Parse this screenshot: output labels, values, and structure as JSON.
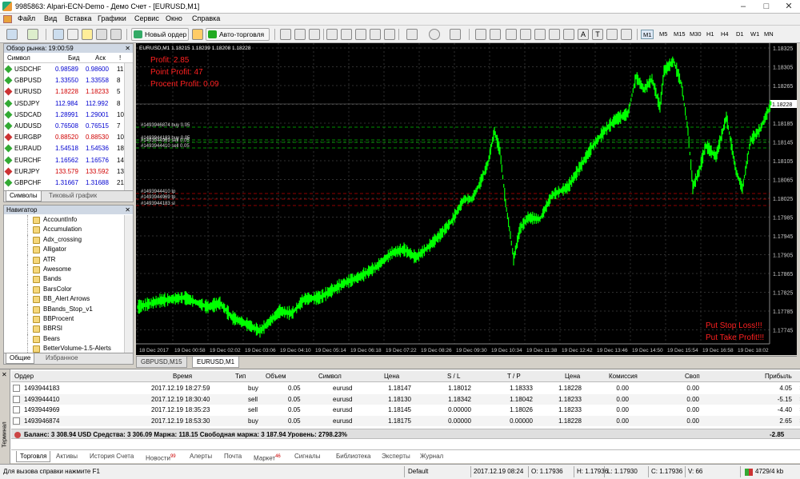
{
  "window": {
    "title": "9985863: Alpari-ECN-Demo - Демо Счет - [EURUSD,M1]"
  },
  "menu": [
    "Файл",
    "Вид",
    "Вставка",
    "Графики",
    "Сервис",
    "Окно",
    "Справка"
  ],
  "toolbar": {
    "new_order": "Новый ордер",
    "auto_trading": "Авто-торговля",
    "timeframes": [
      "M1",
      "M5",
      "M15",
      "M30",
      "H1",
      "H4",
      "D1",
      "W1",
      "MN"
    ],
    "selected_tf": "M1",
    "text_tool": "A",
    "text_tool2": "T"
  },
  "market_watch": {
    "title": "Обзор рынка: 19:00:59",
    "columns": {
      "symbol": "Символ",
      "bid": "Бид",
      "ask": "Аск",
      "spread": "!"
    },
    "rows": [
      {
        "symbol": "USDCHF",
        "bid": "0.98589",
        "ask": "0.98600",
        "spread": "11",
        "dir": "up"
      },
      {
        "symbol": "GBPUSD",
        "bid": "1.33550",
        "ask": "1.33558",
        "spread": "8",
        "dir": "up"
      },
      {
        "symbol": "EURUSD",
        "bid": "1.18228",
        "ask": "1.18233",
        "spread": "5",
        "dir": "down"
      },
      {
        "symbol": "USDJPY",
        "bid": "112.984",
        "ask": "112.992",
        "spread": "8",
        "dir": "up"
      },
      {
        "symbol": "USDCAD",
        "bid": "1.28991",
        "ask": "1.29001",
        "spread": "10",
        "dir": "up"
      },
      {
        "symbol": "AUDUSD",
        "bid": "0.76508",
        "ask": "0.76515",
        "spread": "7",
        "dir": "up"
      },
      {
        "symbol": "EURGBP",
        "bid": "0.88520",
        "ask": "0.88530",
        "spread": "10",
        "dir": "down"
      },
      {
        "symbol": "EURAUD",
        "bid": "1.54518",
        "ask": "1.54536",
        "spread": "18",
        "dir": "up"
      },
      {
        "symbol": "EURCHF",
        "bid": "1.16562",
        "ask": "1.16576",
        "spread": "14",
        "dir": "up"
      },
      {
        "symbol": "EURJPY",
        "bid": "133.579",
        "ask": "133.592",
        "spread": "13",
        "dir": "down"
      },
      {
        "symbol": "GBPCHF",
        "bid": "1.31667",
        "ask": "1.31688",
        "spread": "21",
        "dir": "up"
      },
      {
        "symbol": "CADJPY",
        "bid": "87.583",
        "ask": "87.601",
        "spread": "18",
        "dir": "up"
      }
    ],
    "tabs": [
      "Символы",
      "Тиковый график"
    ]
  },
  "navigator": {
    "title": "Навигатор",
    "items": [
      "AccountInfo",
      "Accumulation",
      "Adx_crossing",
      "Alligator",
      "ATR",
      "Awesome",
      "Bands",
      "BarsColor",
      "BB_Alert Arrows",
      "BBands_Stop_v1",
      "BBProcent",
      "BBRSI",
      "Bears",
      "BetterVolume-1.5-Alerts"
    ],
    "tabs": [
      "Общие",
      "Избранное"
    ]
  },
  "chart": {
    "header": "EURUSD,M1  1.18215 1.18239 1.18208 1.18228",
    "overlay": [
      "Profit: 2.85",
      "Point Profit: 47",
      "Procent Profit: 0.09"
    ],
    "bottom_right": [
      "Put Stop Loss!!!",
      "Put Take Profit!!!"
    ],
    "price_labels": [
      "1.18325",
      "1.18305",
      "1.18265",
      "1.18228",
      "1.18185",
      "1.18145",
      "1.18105",
      "1.18065",
      "1.18025",
      "1.17985",
      "1.17945",
      "1.17905",
      "1.17865",
      "1.17825",
      "1.17785",
      "1.17745"
    ],
    "current_price": "1.18228",
    "time_labels": [
      "18 Dec 2017",
      "19 Dec 00:58",
      "19 Dec 02:02",
      "19 Dec 03:06",
      "19 Dec 04:10",
      "19 Dec 05:14",
      "19 Dec 06:18",
      "19 Dec 07:22",
      "19 Dec 08:26",
      "19 Dec 09:30",
      "19 Dec 10:34",
      "19 Dec 11:38",
      "19 Dec 12:42",
      "19 Dec 13:46",
      "19 Dec 14:50",
      "19 Dec 15:54",
      "19 Dec 16:58",
      "19 Dec 18:02"
    ],
    "order_lines": [
      {
        "label": "#1493946874 buy 0.05",
        "color": "#00c000"
      },
      {
        "label": "#1493944183 buy 0.05",
        "color": "#00c000"
      },
      {
        "label": "#1493944969 sell 0.05",
        "color": "#00c000"
      },
      {
        "label": "#1493944410 sell 0.05",
        "color": "#00c000"
      },
      {
        "label": "#1493944410 tp",
        "color": "#c00000"
      },
      {
        "label": "#1493944969 tp",
        "color": "#c00000"
      },
      {
        "label": "#1493944183 sl",
        "color": "#c00000"
      }
    ],
    "tabs": [
      "GBPUSD,M15",
      "EURUSD,M1"
    ],
    "colors": {
      "bg": "#000000",
      "candle": "#00ff00",
      "grid": "#3c3c3c",
      "text_red": "#ff2020"
    }
  },
  "terminal": {
    "side_label": "Терминал",
    "columns": [
      "Ордер",
      "Время",
      "Тип",
      "Объем",
      "Символ",
      "Цена",
      "S / L",
      "T / P",
      "Цена",
      "Комиссия",
      "Своп",
      "Прибыль"
    ],
    "orders": [
      [
        "1493944183",
        "2017.12.19 18:27:59",
        "buy",
        "0.05",
        "eurusd",
        "1.18147",
        "1.18012",
        "1.18333",
        "1.18228",
        "0.00",
        "0.00",
        "4.05"
      ],
      [
        "1493944410",
        "2017.12.19 18:30:40",
        "sell",
        "0.05",
        "eurusd",
        "1.18130",
        "1.18342",
        "1.18042",
        "1.18233",
        "0.00",
        "0.00",
        "-5.15"
      ],
      [
        "1493944969",
        "2017.12.19 18:35:23",
        "sell",
        "0.05",
        "eurusd",
        "1.18145",
        "0.00000",
        "1.18026",
        "1.18233",
        "0.00",
        "0.00",
        "-4.40"
      ],
      [
        "1493946874",
        "2017.12.19 18:53:30",
        "buy",
        "0.05",
        "eurusd",
        "1.18175",
        "0.00000",
        "0.00000",
        "1.18228",
        "0.00",
        "0.00",
        "2.65"
      ]
    ],
    "balance_line": "Баланс: 3 308.94 USD  Средства: 3 306.09  Маржа: 118.15  Свободная маржа: 3 187.94  Уровень: 2798.23%",
    "total": "-2.85",
    "tabs": [
      {
        "label": "Торговля",
        "badge": ""
      },
      {
        "label": "Активы",
        "badge": ""
      },
      {
        "label": "История Счета",
        "badge": ""
      },
      {
        "label": "Новости",
        "badge": "99"
      },
      {
        "label": "Алерты",
        "badge": ""
      },
      {
        "label": "Почта",
        "badge": ""
      },
      {
        "label": "Маркет",
        "badge": "46"
      },
      {
        "label": "Сигналы",
        "badge": ""
      },
      {
        "label": "Библиотека",
        "badge": ""
      },
      {
        "label": "Эксперты",
        "badge": ""
      },
      {
        "label": "Журнал",
        "badge": ""
      }
    ]
  },
  "status": {
    "help": "Для вызова справки нажмите F1",
    "profile": "Default",
    "datetime": "2017.12.19 08:24",
    "open": "O: 1.17936",
    "high": "H: 1.17936",
    "low": "L: 1.17930",
    "close": "C: 1.17936",
    "volume": "V: 66",
    "traffic": "4729/4 kb"
  }
}
